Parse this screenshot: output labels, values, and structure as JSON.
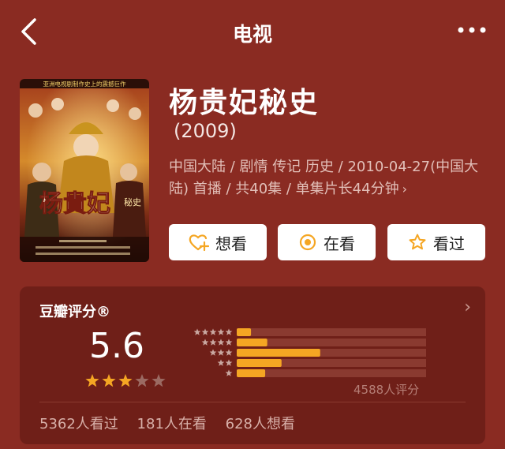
{
  "nav": {
    "title": "电视"
  },
  "movie": {
    "title": "杨贵妃秘史",
    "year": "(2009)",
    "meta": "中国大陆 / 剧情 传记 历史 / 2010-04-27(中国大陆) 首播 / 共40集 / 单集片长44分钟",
    "meta_chevron": "›"
  },
  "poster": {
    "tagline": "亚洲电视剧制作史上的震撼巨作",
    "logo_text": "杨貴妃",
    "logo_sub": "秘史"
  },
  "actions": [
    {
      "label": "想看",
      "icon": "heart-plus-icon"
    },
    {
      "label": "在看",
      "icon": "target-icon"
    },
    {
      "label": "看过",
      "icon": "star-outline-icon"
    }
  ],
  "rating": {
    "header": "豆瓣评分®",
    "chevron": "›",
    "score": "5.6",
    "stars_filled": 3,
    "stars_total": 5,
    "distribution": [
      {
        "stars": 5,
        "fraction": 0.07
      },
      {
        "stars": 4,
        "fraction": 0.15
      },
      {
        "stars": 3,
        "fraction": 0.41
      },
      {
        "stars": 2,
        "fraction": 0.22
      },
      {
        "stars": 1,
        "fraction": 0.14
      }
    ],
    "total": "4588人评分",
    "star_color": "#f5a623",
    "bar_color": "#f5a623"
  },
  "counts": {
    "watched": "5362人看过",
    "watching": "181人在看",
    "want": "628人想看"
  }
}
